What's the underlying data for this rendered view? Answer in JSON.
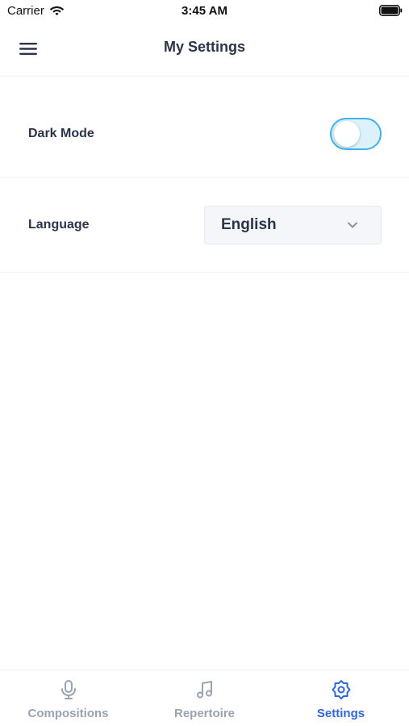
{
  "status_bar": {
    "carrier": "Carrier",
    "time": "3:45 AM"
  },
  "header": {
    "title": "My Settings",
    "menu_icon": "hamburger-menu-icon"
  },
  "settings": {
    "dark_mode": {
      "label": "Dark Mode",
      "enabled": false
    },
    "language": {
      "label": "Language",
      "selected": "English"
    }
  },
  "tab_bar": {
    "tabs": [
      {
        "label": "Compositions",
        "icon": "microphone-icon",
        "active": false
      },
      {
        "label": "Repertoire",
        "icon": "music-note-icon",
        "active": false
      },
      {
        "label": "Settings",
        "icon": "gear-icon",
        "active": true
      }
    ]
  },
  "colors": {
    "accent": "#2f67d6",
    "toggle_border": "#3fb2ea",
    "toggle_track": "#ddf1fb",
    "inactive_tab": "#9aa3b2",
    "text": "#2b3448"
  }
}
